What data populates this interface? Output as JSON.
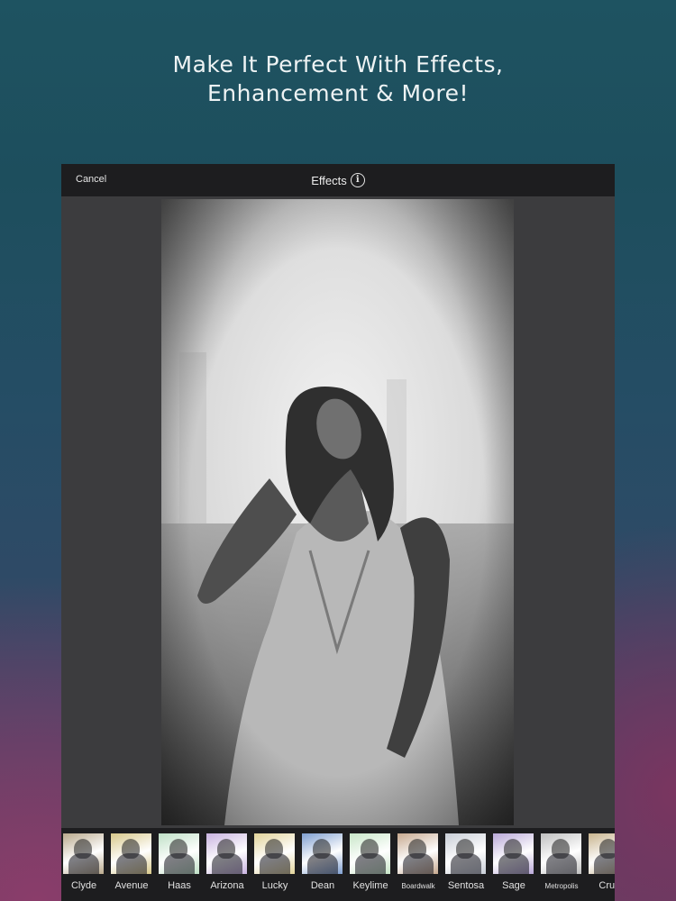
{
  "headline": {
    "line1": "Make It Perfect With Effects,",
    "line2": "Enhancement & More!"
  },
  "editor": {
    "cancel_label": "Cancel",
    "title": "Effects",
    "info_glyph": "i"
  },
  "filters": [
    {
      "label": "Clyde",
      "color": "#b9a98c"
    },
    {
      "label": "Avenue",
      "color": "#d8c88a"
    },
    {
      "label": "Haas",
      "color": "#bfe0c6"
    },
    {
      "label": "Arizona",
      "color": "#c9b3e0"
    },
    {
      "label": "Lucky",
      "color": "#e2d39a"
    },
    {
      "label": "Dean",
      "color": "#7f9fd0"
    },
    {
      "label": "Keylime",
      "color": "#c8e6c8"
    },
    {
      "label": "Boardwalk",
      "color": "#c7a98f"
    },
    {
      "label": "Sentosa",
      "color": "#c8cdd6"
    },
    {
      "label": "Sage",
      "color": "#b9a8d8"
    },
    {
      "label": "Metropolis",
      "color": "#bfbfbf"
    },
    {
      "label": "Cruz",
      "color": "#c8b48e"
    }
  ]
}
